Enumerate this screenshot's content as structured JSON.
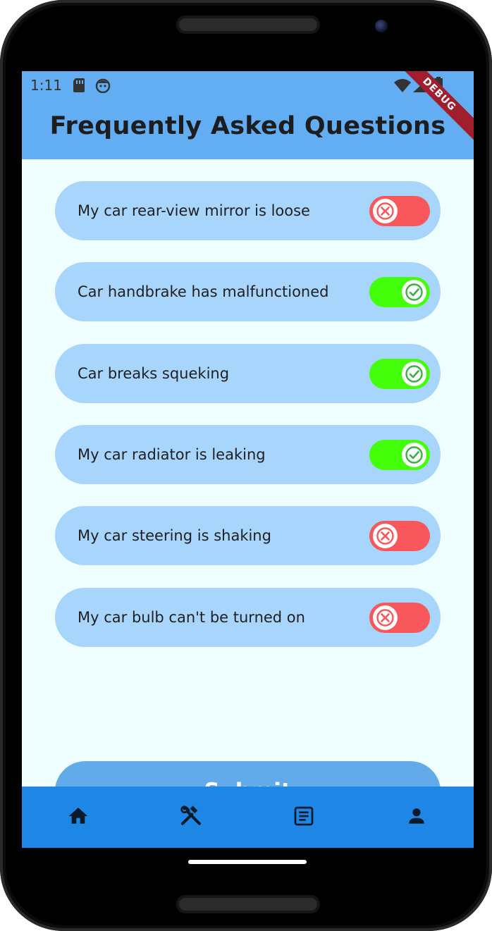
{
  "status_bar": {
    "time": "1:11",
    "debug_banner": "DEBUG"
  },
  "header": {
    "title": "Frequently Asked Questions"
  },
  "faq": {
    "items": [
      {
        "label": "My car rear-view mirror is loose",
        "state": "off"
      },
      {
        "label": "Car handbrake has malfunctioned",
        "state": "on"
      },
      {
        "label": "Car breaks squeking",
        "state": "on"
      },
      {
        "label": "My car radiator is leaking",
        "state": "on"
      },
      {
        "label": "My car steering is shaking",
        "state": "off"
      },
      {
        "label": "My car bulb can't be turned on",
        "state": "off"
      }
    ]
  },
  "submit": {
    "label": "Submit"
  },
  "bottom_nav": {
    "items": [
      {
        "icon": "home-icon"
      },
      {
        "icon": "tools-icon"
      },
      {
        "icon": "article-icon"
      },
      {
        "icon": "person-icon"
      }
    ]
  },
  "colors": {
    "app_bar": "#63adf2",
    "background": "#effefe",
    "faq_pill": "#a8d5fb",
    "toggle_on": "#43ff0a",
    "toggle_off": "#f8575c",
    "submit_button": "#63aaeb",
    "bottom_nav": "#1e87e5"
  }
}
